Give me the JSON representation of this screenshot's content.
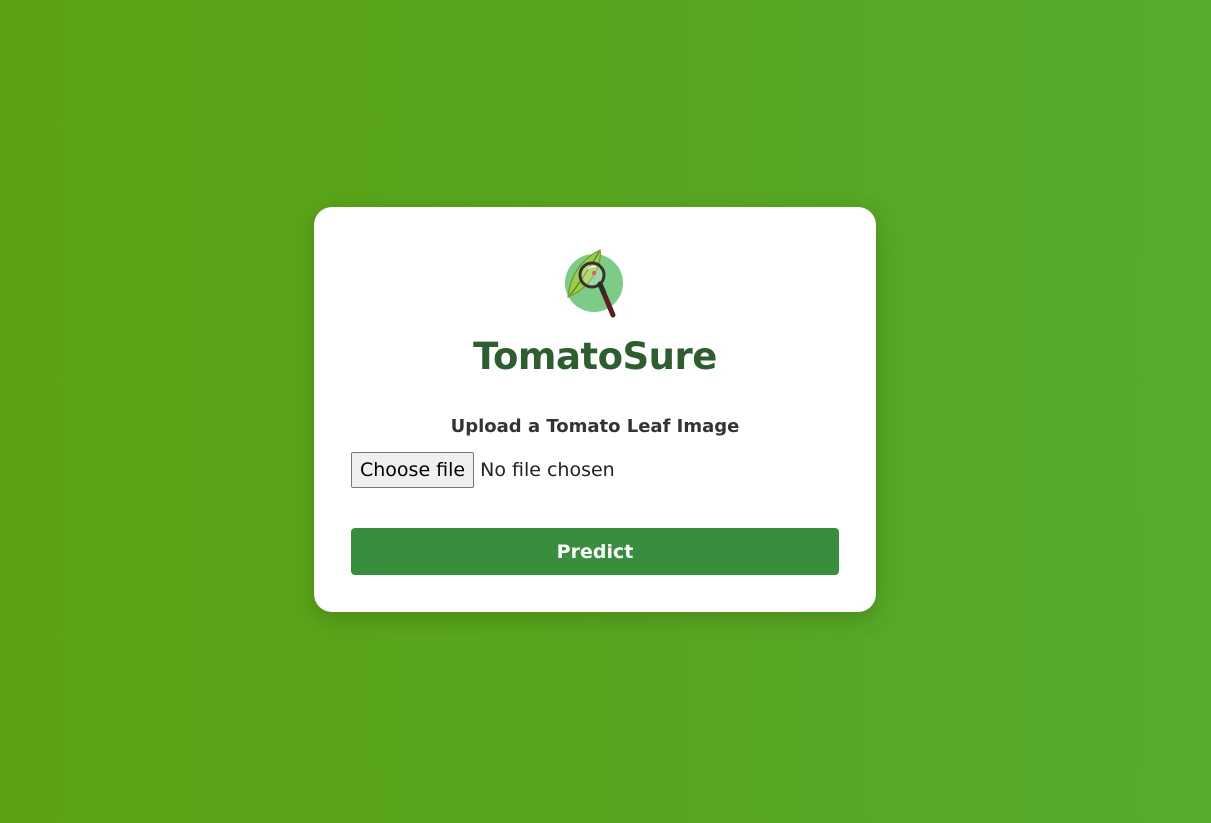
{
  "app": {
    "title": "TomatoSure",
    "logo_icon": "leaf-magnifier-icon"
  },
  "upload": {
    "label": "Upload a Tomato Leaf Image",
    "choose_button_label": "Choose file",
    "file_status": "No file chosen"
  },
  "actions": {
    "predict_label": "Predict"
  },
  "colors": {
    "background_start": "#5ba313",
    "background_end": "#56aa2e",
    "title": "#2e5e2f",
    "predict_button": "#388e3c",
    "card": "#ffffff"
  }
}
